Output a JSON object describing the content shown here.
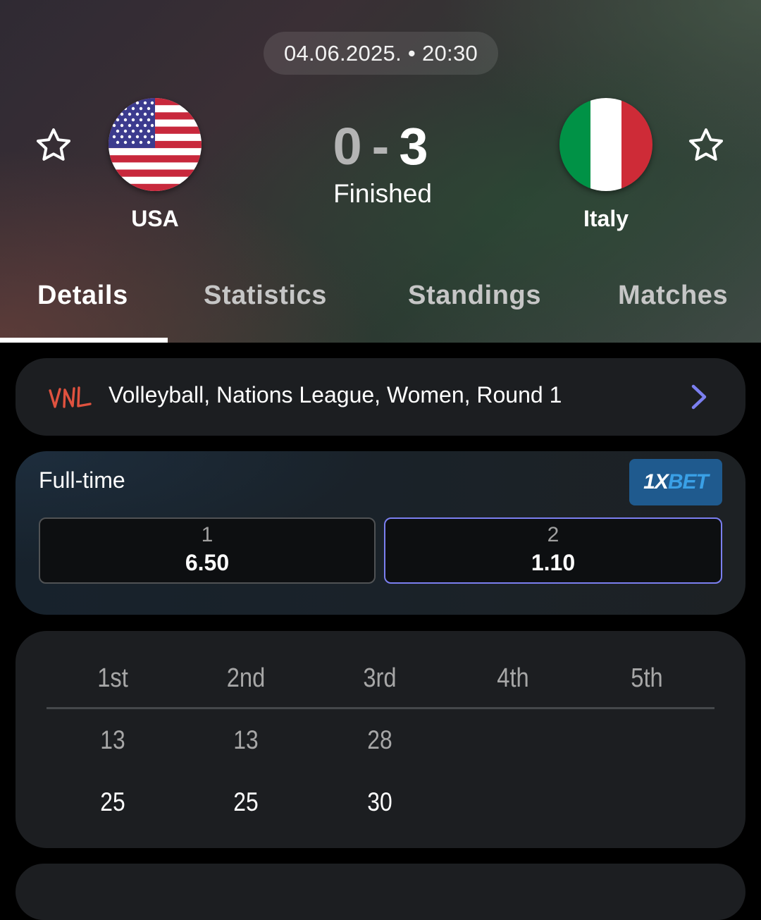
{
  "header": {
    "datetime": "04.06.2025. • 20:30",
    "home_team": {
      "name": "USA",
      "flag": "usa-flag"
    },
    "away_team": {
      "name": "Italy",
      "flag": "italy-flag"
    },
    "score": {
      "home": "0",
      "separator": "-",
      "away": "3"
    },
    "status": "Finished"
  },
  "tabs": [
    {
      "label": "Details",
      "active": true
    },
    {
      "label": "Statistics",
      "active": false
    },
    {
      "label": "Standings",
      "active": false
    },
    {
      "label": "Matches",
      "active": false
    }
  ],
  "league": {
    "logo_text": "VNL",
    "name": "Volleyball, Nations League, Women, Round 1"
  },
  "odds": {
    "title": "Full-time",
    "bookmaker": {
      "part1": "1X",
      "part2": "BET"
    },
    "options": [
      {
        "label": "1",
        "value": "6.50",
        "selected": false
      },
      {
        "label": "2",
        "value": "1.10",
        "selected": true
      }
    ]
  },
  "sets": {
    "headers": [
      "1st",
      "2nd",
      "3rd",
      "4th",
      "5th"
    ],
    "home": [
      "13",
      "13",
      "28",
      "",
      ""
    ],
    "away": [
      "25",
      "25",
      "30",
      "",
      ""
    ]
  },
  "colors": {
    "accent": "#7b7ff0",
    "league_logo": "#e0523f",
    "bookmaker_bg": "#1f5a8e"
  }
}
